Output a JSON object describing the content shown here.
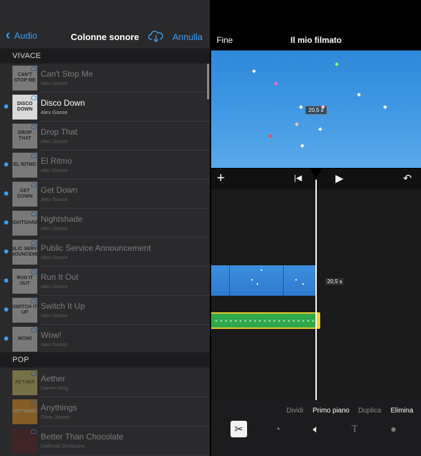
{
  "library": {
    "back_label": "Audio",
    "title": "Colonne sonore",
    "cancel_label": "Annulla",
    "sections": [
      {
        "label": "VIVACE"
      },
      {
        "label": "POP"
      }
    ],
    "tracks": [
      {
        "title": "Can't Stop Me",
        "artist": "Alex Goose",
        "art": "CAN'T STOP ME",
        "dim": true,
        "new": false
      },
      {
        "title": "Disco Down",
        "artist": "Alex Goose",
        "art": "DISCO DOWN",
        "dim": false,
        "new": true
      },
      {
        "title": "Drop That",
        "artist": "Alex Goose",
        "art": "DROP THAT",
        "dim": true,
        "new": false
      },
      {
        "title": "El Ritmo",
        "artist": "Alex Goose",
        "art": "EL RITMO",
        "dim": true,
        "new": true
      },
      {
        "title": "Get Down",
        "artist": "Alex Goose",
        "art": "GET DOWN",
        "dim": true,
        "new": true
      },
      {
        "title": "Nightshade",
        "artist": "Alex Goose",
        "art": "NIGHTSHADE",
        "dim": true,
        "new": true
      },
      {
        "title": "Public Service Announcement",
        "artist": "Alex Goose",
        "art": "PUBLIC SERVICE ANNOUNCEMENT",
        "dim": true,
        "new": true
      },
      {
        "title": "Run It Out",
        "artist": "Alex Goose",
        "art": "RUN IT OUT",
        "dim": true,
        "new": true
      },
      {
        "title": "Switch It Up",
        "artist": "Alex Goose",
        "art": "SWITCH IT UP",
        "dim": true,
        "new": true
      },
      {
        "title": "Wow!",
        "artist": "Alex Goose",
        "art": "WOW!",
        "dim": true,
        "new": true
      },
      {
        "title": "Aether",
        "artist": "Darren King",
        "art": "AETHER",
        "dim": true,
        "new": false
      },
      {
        "title": "Anythings",
        "artist": "Chris James",
        "art": "ANYTHINGS",
        "dim": true,
        "new": false
      },
      {
        "title": "Better Than Chocolate",
        "artist": "Driftmob Orchestra",
        "art": "",
        "dim": true,
        "new": false
      }
    ]
  },
  "editor": {
    "done_label": "Fine",
    "title": "Il mio filmato",
    "preview_duration": "20,5 s",
    "clip_duration": "20,5 s",
    "actions": [
      {
        "label": "Dividi",
        "active": false
      },
      {
        "label": "Primo piano",
        "active": true
      },
      {
        "label": "Duplica",
        "active": false
      },
      {
        "label": "Elimina",
        "active": true
      }
    ],
    "tools": [
      "scissors-icon",
      "speed-icon",
      "volume-icon",
      "text-icon",
      "filter-icon"
    ],
    "accent_color": "#3c9ef5",
    "audio_color": "#2fa84b",
    "selection_color": "#e5c92a"
  }
}
